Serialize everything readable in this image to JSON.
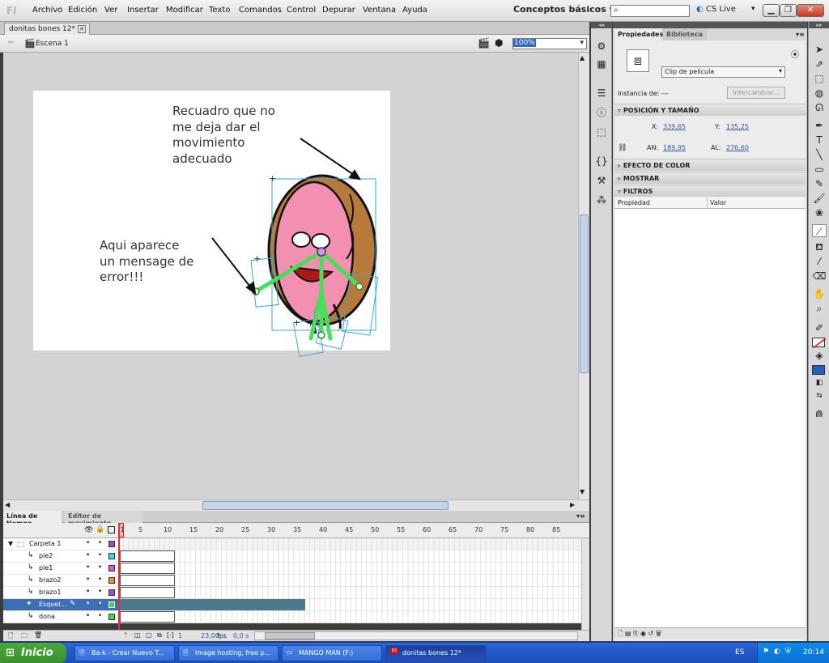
{
  "app": {
    "logo": "Fl",
    "menu": [
      "Archivo",
      "Edición",
      "Ver",
      "Insertar",
      "Modificar",
      "Texto",
      "Comandos",
      "Control",
      "Depurar",
      "Ventana",
      "Ayuda"
    ],
    "workspace": "Conceptos básicos",
    "cs_live": "CS Live"
  },
  "document": {
    "tab_title": "donitas bones 12*",
    "scene": "Escena 1",
    "zoom": "100%"
  },
  "annotations": {
    "top": [
      "Recuadro que no",
      "me deja dar el",
      "movimiento",
      "adecuado"
    ],
    "left": [
      "Aqui aparece",
      "un mensage de",
      "error!!!"
    ]
  },
  "timeline": {
    "tabs": [
      "Línea de tiempo",
      "Editor de movimiento"
    ],
    "frame_numbers": [
      "1",
      "5",
      "10",
      "15",
      "20",
      "25",
      "30",
      "35",
      "40",
      "45",
      "50",
      "55",
      "60",
      "65",
      "70",
      "75",
      "80",
      "85"
    ],
    "layers": [
      {
        "name": "Carpeta 1",
        "type": "folder",
        "color": "#9b4fc7"
      },
      {
        "name": "pie2",
        "type": "layer",
        "color": "#44d6d6"
      },
      {
        "name": "pie1",
        "type": "layer",
        "color": "#d65ad6"
      },
      {
        "name": "brazo2",
        "type": "layer",
        "color": "#f08a2a"
      },
      {
        "name": "brazo1",
        "type": "layer",
        "color": "#9b4fc7"
      },
      {
        "name": "Esquel...",
        "type": "armature",
        "color": "#44d644"
      },
      {
        "name": "dona",
        "type": "layer",
        "color": "#44d644"
      }
    ],
    "footer": {
      "frame": "1",
      "fps": "23,00",
      "fps_unit": "fps",
      "time": "0,0 s"
    }
  },
  "properties": {
    "tabs": [
      "Propiedades",
      "Biblioteca"
    ],
    "symbol_type": "Clip de película",
    "instance_label": "Instancia de:",
    "instance_value": "---",
    "swap_button": "Intercambiar...",
    "section_position": "POSICIÓN Y TAMAÑO",
    "x_label": "X:",
    "x_value": "339,65",
    "y_label": "Y:",
    "y_value": "135,25",
    "w_label": "AN:",
    "w_value": "189,95",
    "h_label": "AL:",
    "h_value": "276,60",
    "section_color": "EFECTO DE COLOR",
    "section_display": "MOSTRAR",
    "section_filters": "FILTROS",
    "col_property": "Propiedad",
    "col_value": "Valor"
  },
  "taskbar": {
    "start": "Inicio",
    "tasks": [
      "Ba-k - Crear Nuevo T...",
      "Image hosting, free p...",
      "MANGO MAN (F:)",
      "donitas bones 12*"
    ],
    "lang": "ES",
    "clock": "20:14"
  },
  "colors": {
    "accent": "#316ac5",
    "bone": "#44e05a",
    "bbox": "#3aa7d6",
    "donut_pink": "#f38fb0",
    "donut_brown": "#b87a3a"
  }
}
